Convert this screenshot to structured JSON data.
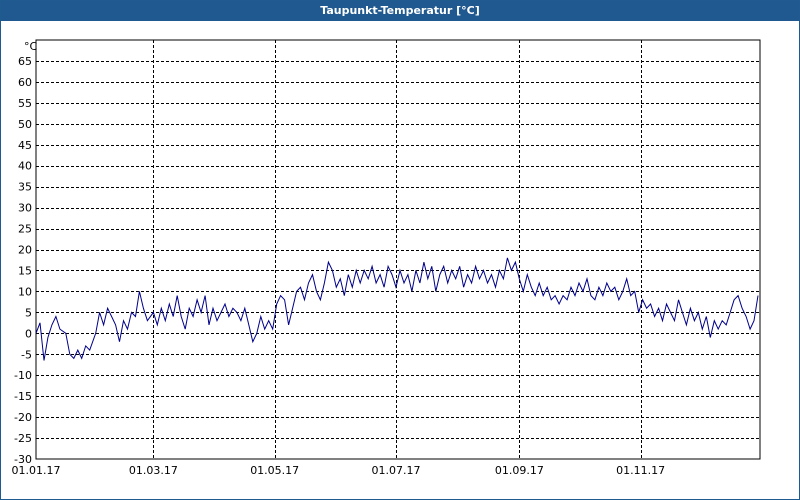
{
  "window": {
    "title": "Taupunkt-Temperatur [°C]"
  },
  "chart_data": {
    "type": "line",
    "title": "Taupunkt-Temperatur [°C]",
    "ylabel": "°C",
    "xlabel": "",
    "ylim": [
      -30,
      70
    ],
    "xlim": [
      "2017-01-01",
      "2017-12-31"
    ],
    "grid": true,
    "y_ticks": [
      "65",
      "60",
      "55",
      "50",
      "45",
      "40",
      "35",
      "30",
      "25",
      "20",
      "15",
      "10",
      "5",
      "0",
      "-5",
      "-10",
      "-15",
      "-20",
      "-25",
      "-30"
    ],
    "x_ticks": [
      {
        "label": "01.01.17",
        "date": "2017-01-01"
      },
      {
        "label": "01.03.17",
        "date": "2017-03-01"
      },
      {
        "label": "01.05.17",
        "date": "2017-05-01"
      },
      {
        "label": "01.07.17",
        "date": "2017-07-01"
      },
      {
        "label": "01.09.17",
        "date": "2017-09-01"
      },
      {
        "label": "01.11.17",
        "date": "2017-11-01"
      }
    ],
    "line_color": "#00008b",
    "series": [
      {
        "values": [
          {
            "date": "2017-01-01",
            "y": 0
          },
          {
            "date": "2017-01-03",
            "y": 2.5
          },
          {
            "date": "2017-01-05",
            "y": -6.5
          },
          {
            "date": "2017-01-07",
            "y": -1
          },
          {
            "date": "2017-01-09",
            "y": 2
          },
          {
            "date": "2017-01-11",
            "y": 4
          },
          {
            "date": "2017-01-13",
            "y": 1
          },
          {
            "date": "2017-01-16",
            "y": 0
          },
          {
            "date": "2017-01-18",
            "y": -5
          },
          {
            "date": "2017-01-20",
            "y": -6
          },
          {
            "date": "2017-01-22",
            "y": -4
          },
          {
            "date": "2017-01-24",
            "y": -6
          },
          {
            "date": "2017-01-26",
            "y": -3
          },
          {
            "date": "2017-01-28",
            "y": -4
          },
          {
            "date": "2017-01-31",
            "y": 0
          },
          {
            "date": "2017-02-02",
            "y": 5
          },
          {
            "date": "2017-02-04",
            "y": 2
          },
          {
            "date": "2017-02-06",
            "y": 6
          },
          {
            "date": "2017-02-08",
            "y": 4
          },
          {
            "date": "2017-02-10",
            "y": 2
          },
          {
            "date": "2017-02-12",
            "y": -2
          },
          {
            "date": "2017-02-14",
            "y": 3
          },
          {
            "date": "2017-02-16",
            "y": 1
          },
          {
            "date": "2017-02-18",
            "y": 5
          },
          {
            "date": "2017-02-20",
            "y": 4
          },
          {
            "date": "2017-02-22",
            "y": 10
          },
          {
            "date": "2017-02-24",
            "y": 6
          },
          {
            "date": "2017-02-26",
            "y": 3
          },
          {
            "date": "2017-03-01",
            "y": 5
          },
          {
            "date": "2017-03-03",
            "y": 2
          },
          {
            "date": "2017-03-05",
            "y": 6
          },
          {
            "date": "2017-03-07",
            "y": 3
          },
          {
            "date": "2017-03-09",
            "y": 7
          },
          {
            "date": "2017-03-11",
            "y": 4
          },
          {
            "date": "2017-03-13",
            "y": 9
          },
          {
            "date": "2017-03-15",
            "y": 4
          },
          {
            "date": "2017-03-17",
            "y": 1
          },
          {
            "date": "2017-03-19",
            "y": 6
          },
          {
            "date": "2017-03-21",
            "y": 4
          },
          {
            "date": "2017-03-23",
            "y": 8
          },
          {
            "date": "2017-03-25",
            "y": 5
          },
          {
            "date": "2017-03-27",
            "y": 9
          },
          {
            "date": "2017-03-29",
            "y": 2
          },
          {
            "date": "2017-03-31",
            "y": 6
          },
          {
            "date": "2017-04-02",
            "y": 3
          },
          {
            "date": "2017-04-04",
            "y": 5
          },
          {
            "date": "2017-04-06",
            "y": 7
          },
          {
            "date": "2017-04-08",
            "y": 4
          },
          {
            "date": "2017-04-10",
            "y": 6
          },
          {
            "date": "2017-04-12",
            "y": 5
          },
          {
            "date": "2017-04-14",
            "y": 3
          },
          {
            "date": "2017-04-16",
            "y": 6
          },
          {
            "date": "2017-04-18",
            "y": 2
          },
          {
            "date": "2017-04-20",
            "y": -2
          },
          {
            "date": "2017-04-22",
            "y": 0
          },
          {
            "date": "2017-04-24",
            "y": 4
          },
          {
            "date": "2017-04-26",
            "y": 1
          },
          {
            "date": "2017-04-28",
            "y": 3
          },
          {
            "date": "2017-04-30",
            "y": 1
          },
          {
            "date": "2017-05-02",
            "y": 7
          },
          {
            "date": "2017-05-04",
            "y": 9
          },
          {
            "date": "2017-05-06",
            "y": 8
          },
          {
            "date": "2017-05-08",
            "y": 2
          },
          {
            "date": "2017-05-10",
            "y": 6
          },
          {
            "date": "2017-05-12",
            "y": 10
          },
          {
            "date": "2017-05-14",
            "y": 11
          },
          {
            "date": "2017-05-16",
            "y": 8
          },
          {
            "date": "2017-05-18",
            "y": 12
          },
          {
            "date": "2017-05-20",
            "y": 14
          },
          {
            "date": "2017-05-22",
            "y": 10
          },
          {
            "date": "2017-05-24",
            "y": 8
          },
          {
            "date": "2017-05-26",
            "y": 12
          },
          {
            "date": "2017-05-28",
            "y": 17
          },
          {
            "date": "2017-05-30",
            "y": 15
          },
          {
            "date": "2017-06-01",
            "y": 11
          },
          {
            "date": "2017-06-03",
            "y": 13
          },
          {
            "date": "2017-06-05",
            "y": 9
          },
          {
            "date": "2017-06-07",
            "y": 14
          },
          {
            "date": "2017-06-09",
            "y": 11
          },
          {
            "date": "2017-06-11",
            "y": 15
          },
          {
            "date": "2017-06-13",
            "y": 12
          },
          {
            "date": "2017-06-15",
            "y": 15
          },
          {
            "date": "2017-06-17",
            "y": 13
          },
          {
            "date": "2017-06-19",
            "y": 16
          },
          {
            "date": "2017-06-21",
            "y": 12
          },
          {
            "date": "2017-06-23",
            "y": 14
          },
          {
            "date": "2017-06-25",
            "y": 11
          },
          {
            "date": "2017-06-27",
            "y": 16
          },
          {
            "date": "2017-06-29",
            "y": 14
          },
          {
            "date": "2017-07-01",
            "y": 11
          },
          {
            "date": "2017-07-03",
            "y": 15
          },
          {
            "date": "2017-07-05",
            "y": 12
          },
          {
            "date": "2017-07-07",
            "y": 14
          },
          {
            "date": "2017-07-09",
            "y": 10
          },
          {
            "date": "2017-07-11",
            "y": 15
          },
          {
            "date": "2017-07-13",
            "y": 12
          },
          {
            "date": "2017-07-15",
            "y": 17
          },
          {
            "date": "2017-07-17",
            "y": 13
          },
          {
            "date": "2017-07-19",
            "y": 16
          },
          {
            "date": "2017-07-21",
            "y": 10
          },
          {
            "date": "2017-07-23",
            "y": 14
          },
          {
            "date": "2017-07-25",
            "y": 16
          },
          {
            "date": "2017-07-27",
            "y": 12
          },
          {
            "date": "2017-07-29",
            "y": 15
          },
          {
            "date": "2017-07-31",
            "y": 13
          },
          {
            "date": "2017-08-02",
            "y": 16
          },
          {
            "date": "2017-08-04",
            "y": 11
          },
          {
            "date": "2017-08-06",
            "y": 14
          },
          {
            "date": "2017-08-08",
            "y": 12
          },
          {
            "date": "2017-08-10",
            "y": 16
          },
          {
            "date": "2017-08-12",
            "y": 13
          },
          {
            "date": "2017-08-14",
            "y": 15
          },
          {
            "date": "2017-08-16",
            "y": 12
          },
          {
            "date": "2017-08-18",
            "y": 14
          },
          {
            "date": "2017-08-20",
            "y": 11
          },
          {
            "date": "2017-08-22",
            "y": 15
          },
          {
            "date": "2017-08-24",
            "y": 13
          },
          {
            "date": "2017-08-26",
            "y": 18
          },
          {
            "date": "2017-08-28",
            "y": 15
          },
          {
            "date": "2017-08-30",
            "y": 17
          },
          {
            "date": "2017-09-01",
            "y": 13
          },
          {
            "date": "2017-09-03",
            "y": 10
          },
          {
            "date": "2017-09-05",
            "y": 14
          },
          {
            "date": "2017-09-07",
            "y": 11
          },
          {
            "date": "2017-09-09",
            "y": 9
          },
          {
            "date": "2017-09-11",
            "y": 12
          },
          {
            "date": "2017-09-13",
            "y": 9
          },
          {
            "date": "2017-09-15",
            "y": 11
          },
          {
            "date": "2017-09-17",
            "y": 8
          },
          {
            "date": "2017-09-19",
            "y": 9
          },
          {
            "date": "2017-09-21",
            "y": 7
          },
          {
            "date": "2017-09-23",
            "y": 9
          },
          {
            "date": "2017-09-25",
            "y": 8
          },
          {
            "date": "2017-09-27",
            "y": 11
          },
          {
            "date": "2017-09-29",
            "y": 9
          },
          {
            "date": "2017-10-01",
            "y": 12
          },
          {
            "date": "2017-10-03",
            "y": 10
          },
          {
            "date": "2017-10-05",
            "y": 13
          },
          {
            "date": "2017-10-07",
            "y": 9
          },
          {
            "date": "2017-10-09",
            "y": 8
          },
          {
            "date": "2017-10-11",
            "y": 11
          },
          {
            "date": "2017-10-13",
            "y": 9
          },
          {
            "date": "2017-10-15",
            "y": 12
          },
          {
            "date": "2017-10-17",
            "y": 10
          },
          {
            "date": "2017-10-19",
            "y": 11
          },
          {
            "date": "2017-10-21",
            "y": 8
          },
          {
            "date": "2017-10-23",
            "y": 10
          },
          {
            "date": "2017-10-25",
            "y": 13
          },
          {
            "date": "2017-10-27",
            "y": 9
          },
          {
            "date": "2017-10-29",
            "y": 10
          },
          {
            "date": "2017-10-31",
            "y": 5
          },
          {
            "date": "2017-11-02",
            "y": 8
          },
          {
            "date": "2017-11-04",
            "y": 6
          },
          {
            "date": "2017-11-06",
            "y": 7
          },
          {
            "date": "2017-11-08",
            "y": 4
          },
          {
            "date": "2017-11-10",
            "y": 6
          },
          {
            "date": "2017-11-12",
            "y": 3
          },
          {
            "date": "2017-11-14",
            "y": 7
          },
          {
            "date": "2017-11-16",
            "y": 5
          },
          {
            "date": "2017-11-18",
            "y": 3
          },
          {
            "date": "2017-11-20",
            "y": 8
          },
          {
            "date": "2017-11-22",
            "y": 5
          },
          {
            "date": "2017-11-24",
            "y": 2
          },
          {
            "date": "2017-11-26",
            "y": 6
          },
          {
            "date": "2017-11-28",
            "y": 3
          },
          {
            "date": "2017-11-30",
            "y": 5
          },
          {
            "date": "2017-12-02",
            "y": 1
          },
          {
            "date": "2017-12-04",
            "y": 4
          },
          {
            "date": "2017-12-06",
            "y": -1
          },
          {
            "date": "2017-12-08",
            "y": 3
          },
          {
            "date": "2017-12-10",
            "y": 1
          },
          {
            "date": "2017-12-12",
            "y": 3
          },
          {
            "date": "2017-12-14",
            "y": 2
          },
          {
            "date": "2017-12-16",
            "y": 5
          },
          {
            "date": "2017-12-18",
            "y": 8
          },
          {
            "date": "2017-12-20",
            "y": 9
          },
          {
            "date": "2017-12-22",
            "y": 6
          },
          {
            "date": "2017-12-24",
            "y": 4
          },
          {
            "date": "2017-12-26",
            "y": 1
          },
          {
            "date": "2017-12-28",
            "y": 3
          },
          {
            "date": "2017-12-30",
            "y": 9
          }
        ]
      }
    ]
  }
}
